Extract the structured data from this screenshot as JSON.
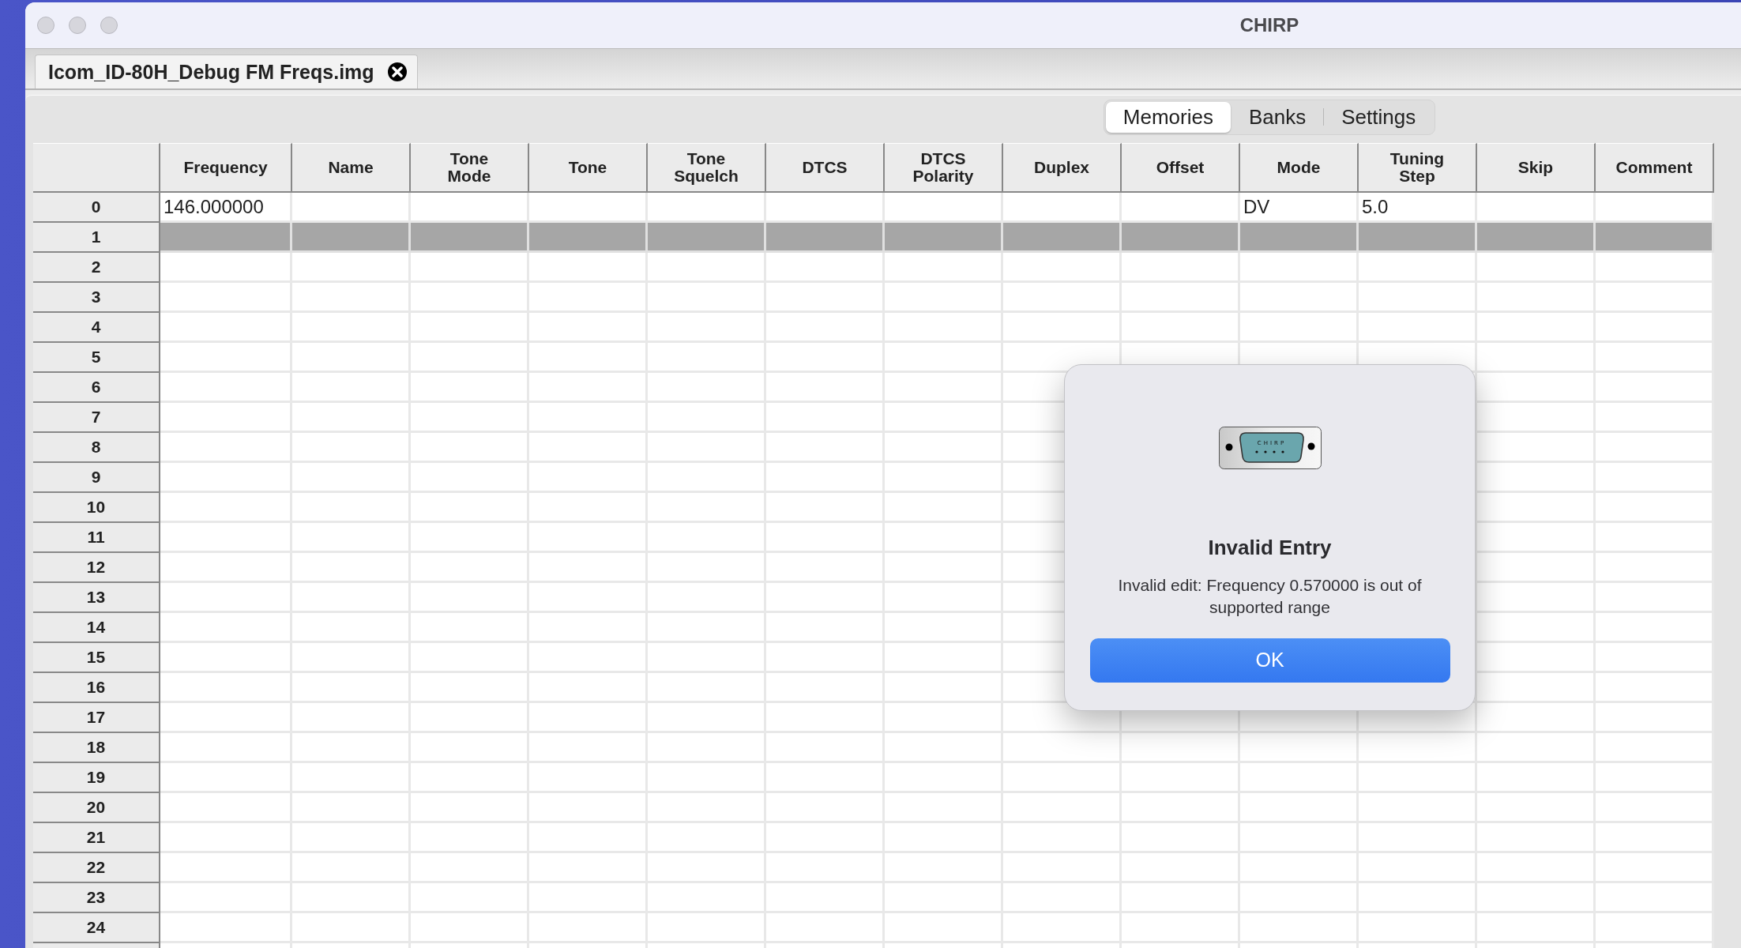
{
  "window": {
    "title": "CHIRP"
  },
  "document_tabs": [
    {
      "label": "Icom_ID-80H_Debug FM Freqs.img",
      "selected": true
    }
  ],
  "view_tabs": [
    {
      "label": "Memories",
      "selected": true
    },
    {
      "label": "Banks",
      "selected": false
    },
    {
      "label": "Settings",
      "selected": false
    }
  ],
  "table": {
    "columns": [
      "Frequency",
      "Name",
      "Tone Mode",
      "Tone",
      "Tone Squelch",
      "DTCS",
      "DTCS Polarity",
      "Duplex",
      "Offset",
      "Mode",
      "Tuning Step",
      "Skip",
      "Comment"
    ],
    "rows": [
      {
        "number": "0",
        "selected": false,
        "cells": [
          "146.000000",
          null,
          null,
          null,
          null,
          null,
          null,
          null,
          null,
          "DV",
          "5.0",
          null,
          null
        ]
      },
      {
        "number": "1",
        "selected": true,
        "cells": {}
      },
      {
        "number": "2",
        "selected": false,
        "cells": {}
      },
      {
        "number": "3",
        "selected": false,
        "cells": {}
      },
      {
        "number": "4",
        "selected": false,
        "cells": {}
      },
      {
        "number": "5",
        "selected": false,
        "cells": {}
      },
      {
        "number": "6",
        "selected": false,
        "cells": {}
      },
      {
        "number": "7",
        "selected": false,
        "cells": {}
      },
      {
        "number": "8",
        "selected": false,
        "cells": {}
      },
      {
        "number": "9",
        "selected": false,
        "cells": {}
      },
      {
        "number": "10",
        "selected": false,
        "cells": {}
      },
      {
        "number": "11",
        "selected": false,
        "cells": {}
      },
      {
        "number": "12",
        "selected": false,
        "cells": {}
      },
      {
        "number": "13",
        "selected": false,
        "cells": {}
      },
      {
        "number": "14",
        "selected": false,
        "cells": {}
      },
      {
        "number": "15",
        "selected": false,
        "cells": {}
      },
      {
        "number": "16",
        "selected": false,
        "cells": {}
      },
      {
        "number": "17",
        "selected": false,
        "cells": {}
      },
      {
        "number": "18",
        "selected": false,
        "cells": {}
      },
      {
        "number": "19",
        "selected": false,
        "cells": {}
      },
      {
        "number": "20",
        "selected": false,
        "cells": {}
      },
      {
        "number": "21",
        "selected": false,
        "cells": {}
      },
      {
        "number": "22",
        "selected": false,
        "cells": {}
      },
      {
        "number": "23",
        "selected": false,
        "cells": {}
      },
      {
        "number": "24",
        "selected": false,
        "cells": {}
      }
    ]
  },
  "dialog": {
    "icon_label": "CHIRP",
    "title": "Invalid Entry",
    "message": "Invalid edit: Frequency 0.570000 is out of supported range",
    "buttons": [
      "OK"
    ]
  }
}
